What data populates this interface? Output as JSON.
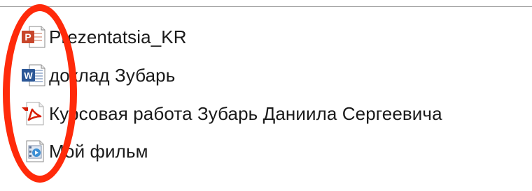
{
  "files": [
    {
      "name": "Prezentatsia_KR",
      "icon": "powerpoint-icon"
    },
    {
      "name": "доклад Зубарь",
      "icon": "word-icon"
    },
    {
      "name": "Курсовая работа Зубарь Даниила Сергеевича",
      "icon": "pdf-icon"
    },
    {
      "name": "Мой фильм",
      "icon": "video-icon"
    }
  ],
  "colors": {
    "annotation": "#ff2a0a",
    "powerpoint": "#c8462b",
    "word": "#2b5797",
    "pdf": "#d81e05"
  }
}
